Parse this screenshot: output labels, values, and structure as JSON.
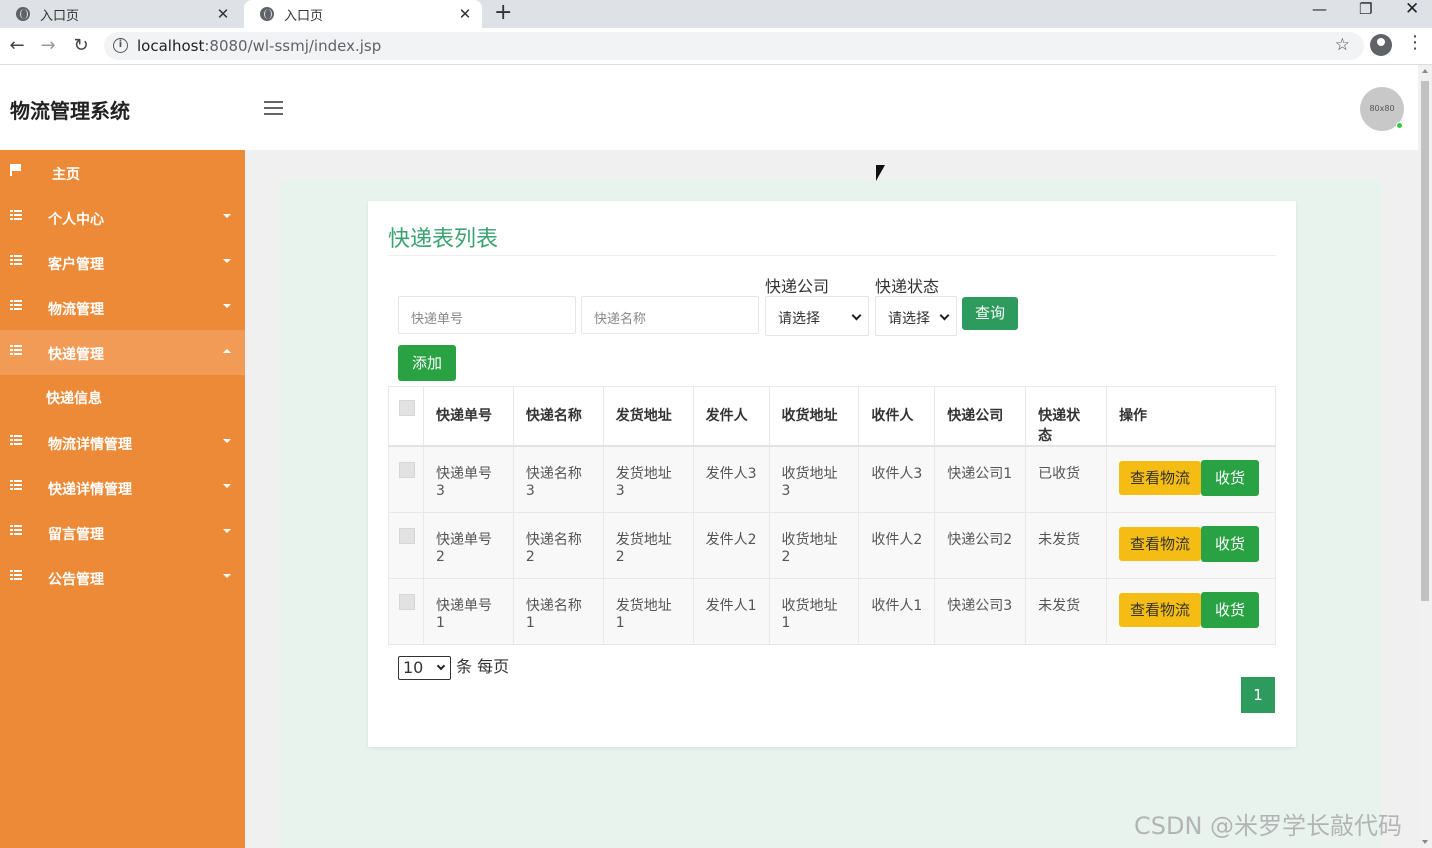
{
  "browser": {
    "tabs": [
      {
        "title": "入口页"
      },
      {
        "title": "入口页"
      }
    ],
    "url_host": "localhost",
    "url_rest": ":8080/wl-ssmj/index.jsp"
  },
  "header": {
    "brand": "物流管理系统",
    "avatar_text": "80x80"
  },
  "sidebar": {
    "items": [
      {
        "label": "主页"
      },
      {
        "label": "个人中心"
      },
      {
        "label": "客户管理"
      },
      {
        "label": "物流管理"
      },
      {
        "label": "快递管理"
      },
      {
        "label": "快递信息"
      },
      {
        "label": "物流详情管理"
      },
      {
        "label": "快递详情管理"
      },
      {
        "label": "留言管理"
      },
      {
        "label": "公告管理"
      }
    ]
  },
  "main": {
    "title": "快递表列表",
    "search": {
      "number_placeholder": "快递单号",
      "name_placeholder": "快递名称",
      "company_label": "快递公司",
      "company_value": "请选择",
      "status_label": "快递状态",
      "status_value": "请选择",
      "query_label": "查询"
    },
    "add_label": "添加",
    "table": {
      "headers": [
        "快递单号",
        "快递名称",
        "发货地址",
        "发件人",
        "收货地址",
        "收件人",
        "快递公司",
        "快递状态",
        "操作"
      ],
      "rows": [
        {
          "number": "快递单号3",
          "name": "快递名称3",
          "from": "发货地址3",
          "sender": "发件人3",
          "to": "收货地址3",
          "receiver": "收件人3",
          "company": "快递公司1",
          "status": "已收货"
        },
        {
          "number": "快递单号2",
          "name": "快递名称2",
          "from": "发货地址2",
          "sender": "发件人2",
          "to": "收货地址2",
          "receiver": "收件人2",
          "company": "快递公司2",
          "status": "未发货"
        },
        {
          "number": "快递单号1",
          "name": "快递名称1",
          "from": "发货地址1",
          "sender": "发件人1",
          "to": "收货地址1",
          "receiver": "收件人1",
          "company": "快递公司3",
          "status": "未发货"
        }
      ],
      "view_label": "查看物流",
      "receive_label": "收货"
    },
    "page_size": "10",
    "page_size_suffix": "条 每页",
    "current_page": "1"
  },
  "watermark": "CSDN @米罗学长敲代码",
  "colors": {
    "sidebar": "#ed8a37",
    "accent_green": "#2d9a5e",
    "title_green": "#3aa371",
    "view_yellow": "#f5bd14"
  }
}
